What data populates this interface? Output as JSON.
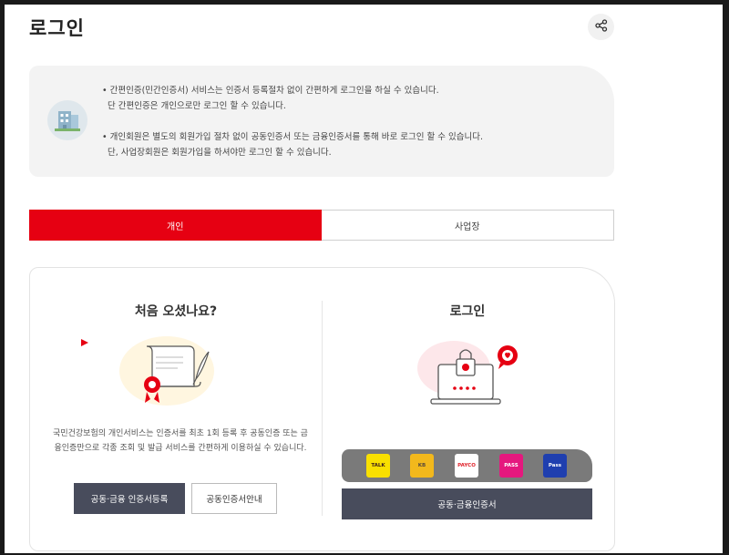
{
  "header": {
    "title": "로그인",
    "share_icon": "share-icon"
  },
  "info": {
    "icon": "building-icon",
    "lines": [
      "• 간편인증(민간인증서) 서비스는 인증서 등록절차 없이 간편하게 로그인을 하실 수 있습니다.",
      "단 간편인증은 개인으로만 로그인 할 수 있습니다.",
      "• 개인회원은 별도의 회원가입 절차 없이 공동인증서 또는 금융인증서를 통해 바로 로그인 할 수 있습니다.",
      "단, 사업장회원은 회원가입을 하셔야만 로그인 할 수 있습니다."
    ]
  },
  "tabs": [
    {
      "label": "개인",
      "active": true
    },
    {
      "label": "사업장",
      "active": false
    }
  ],
  "first_visit": {
    "title": "처음 오셨나요?",
    "illustration": "certificate-scroll-icon",
    "description": "국민건강보험의 개인서비스는 인증서를 최초 1회 등록 후 공동인증 또는 금융인증만으로 각종 조회 및 발급 서비스를 간편하게 이용하실 수 있습니다.",
    "register_button": "공동·금융 인증서등록",
    "guide_button": "공동인증서안내"
  },
  "login": {
    "title": "로그인",
    "illustration": "laptop-lock-icon",
    "providers": [
      {
        "name": "kakao-icon",
        "label": "TALK",
        "bg": "#f9e000",
        "fg": "#3c1e1e"
      },
      {
        "name": "kb-icon",
        "label": "KB",
        "bg": "#f2b81c",
        "fg": "#5a4a3a"
      },
      {
        "name": "payco-icon",
        "label": "PAYCO",
        "bg": "#ffffff",
        "fg": "#e0252d"
      },
      {
        "name": "pass-icon",
        "label": "PASS",
        "bg": "#e5187e",
        "fg": "#ffffff"
      },
      {
        "name": "samsung-pass-icon",
        "label": "Pass",
        "bg": "#1f3faf",
        "fg": "#ffffff"
      }
    ],
    "cert_button": "공동·금융인증서"
  },
  "colors": {
    "accent": "#e60012",
    "dark_button": "#484c5c",
    "panel_bg": "#f3f3f3"
  }
}
